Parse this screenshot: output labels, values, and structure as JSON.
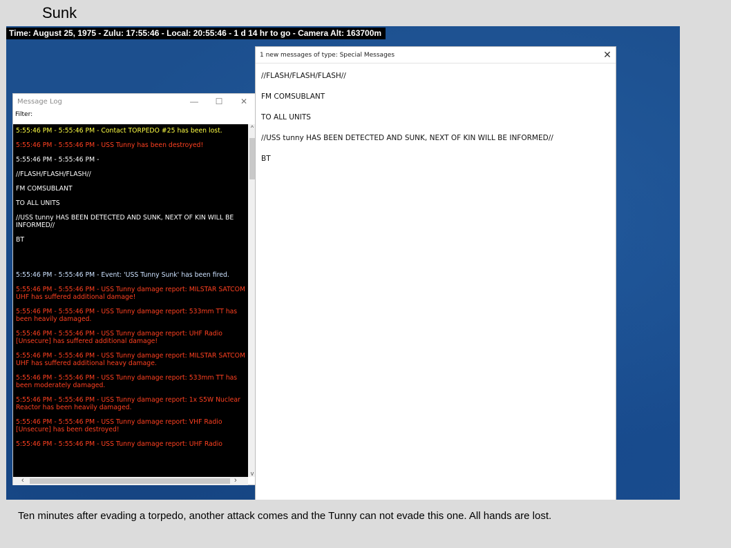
{
  "page": {
    "title": "Sunk",
    "caption": "Ten minutes after evading a torpedo, another attack comes and the Tunny can not evade this one.  All hands are lost."
  },
  "status_bar": {
    "text": "Time: August 25, 1975 - Zulu: 17:55:46 - Local: 20:55:46 - 1 d 14 hr to go -  Camera Alt: 163700m"
  },
  "message_log": {
    "title": "Message Log",
    "filter_label": "Filter:",
    "lines": [
      {
        "text": "5:55:46 PM - 5:55:46 PM - Contact TORPEDO #25 has been lost.",
        "color": "#ffff44"
      },
      {
        "text": "5:55:46 PM - 5:55:46 PM - USS Tunny has been destroyed!",
        "color": "#ff4020"
      },
      {
        "text": "5:55:46 PM - 5:55:46 PM -",
        "color": "#ffffff"
      },
      {
        "text": "//FLASH/FLASH/FLASH//",
        "color": "#ffffff"
      },
      {
        "text": "FM COMSUBLANT",
        "color": "#ffffff"
      },
      {
        "text": "TO ALL UNITS",
        "color": "#ffffff"
      },
      {
        "text": "//USS tunny HAS BEEN DETECTED AND SUNK, NEXT OF KIN WILL BE INFORMED//",
        "color": "#ffffff"
      },
      {
        "text": "BT",
        "color": "#ffffff"
      },
      {
        "text": "5:55:46 PM - 5:55:46 PM - Event: 'USS Tunny Sunk' has been fired.",
        "color": "#cde2ff"
      },
      {
        "text": "5:55:46 PM - 5:55:46 PM - USS Tunny damage report: MILSTAR SATCOM UHF has suffered additional damage!",
        "color": "#ff4020"
      },
      {
        "text": "5:55:46 PM - 5:55:46 PM - USS Tunny damage report: 533mm TT has been heavily damaged.",
        "color": "#ff4020"
      },
      {
        "text": "5:55:46 PM - 5:55:46 PM - USS Tunny damage report: UHF Radio [Unsecure] has suffered additional damage!",
        "color": "#ff4020"
      },
      {
        "text": "5:55:46 PM - 5:55:46 PM - USS Tunny damage report: MILSTAR SATCOM UHF has suffered additional heavy damage.",
        "color": "#ff4020"
      },
      {
        "text": "5:55:46 PM - 5:55:46 PM - USS Tunny damage report: 533mm TT has been moderately damaged.",
        "color": "#ff4020"
      },
      {
        "text": "5:55:46 PM - 5:55:46 PM - USS Tunny damage report: 1x S5W Nuclear Reactor has been heavily damaged.",
        "color": "#ff4020"
      },
      {
        "text": "5:55:46 PM - 5:55:46 PM - USS Tunny damage report: VHF Radio [Unsecure] has been destroyed!",
        "color": "#ff4020"
      },
      {
        "text": "5:55:46 PM - 5:55:46 PM - USS Tunny damage report: UHF Radio",
        "color": "#ff4020"
      }
    ]
  },
  "popup": {
    "title": "1 new messages of type: Special Messages",
    "lines": [
      "//FLASH/FLASH/FLASH//",
      "FM COMSUBLANT",
      "TO ALL UNITS",
      "//USS tunny HAS BEEN DETECTED AND SUNK, NEXT OF KIN WILL BE INFORMED//",
      "BT"
    ]
  },
  "icons": {
    "minimize": "minimize-icon",
    "maximize": "maximize-icon",
    "close": "close-icon"
  }
}
